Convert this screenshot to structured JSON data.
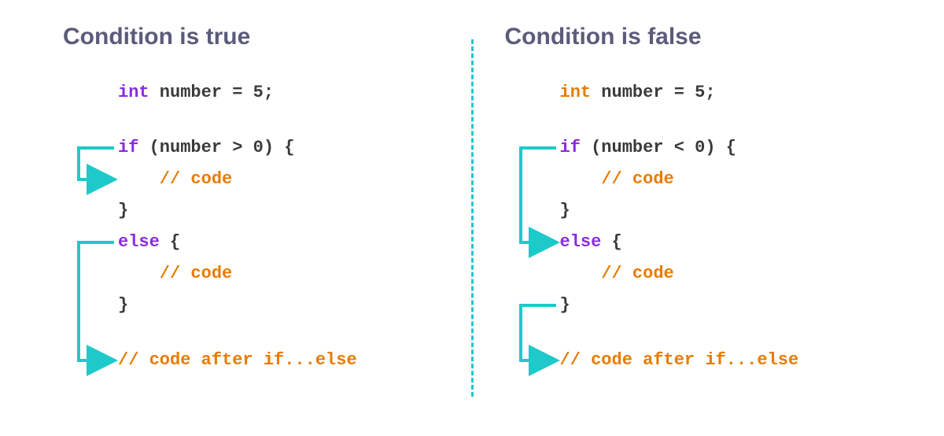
{
  "colors": {
    "title": "#5b5b7a",
    "keyword_purple": "#8a2be2",
    "keyword_orange": "#e87b00",
    "text": "#3a3a3a",
    "comment": "#e87b00",
    "arrow": "#1ec9c9",
    "divider": "#1ec9c9"
  },
  "left": {
    "title": "Condition is true",
    "decl_kw": "int",
    "decl_rest": " number = 5;",
    "if_kw": "if",
    "if_cond": " (number > 0) {",
    "indent_comment": "    // code",
    "close": "}",
    "else_kw": "else",
    "else_rest": " {",
    "after_comment": "// code after if...else"
  },
  "right": {
    "title": "Condition is false",
    "decl_kw": "int",
    "decl_rest": " number = 5;",
    "if_kw": "if",
    "if_cond": " (number < 0) {",
    "indent_comment": "    // code",
    "close": "}",
    "else_kw": "else",
    "else_rest": " {",
    "after_comment": "// code after if...else"
  }
}
